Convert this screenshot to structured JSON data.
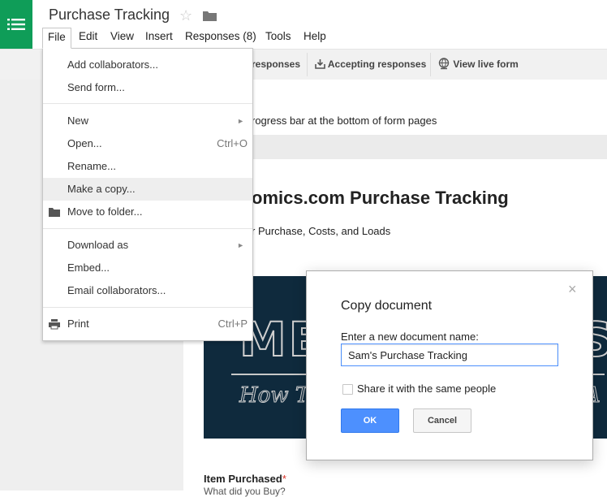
{
  "header": {
    "title": "Purchase Tracking",
    "star_icon": "star-icon",
    "folder_icon": "folder-icon",
    "app_icon": "forms-list-icon",
    "brand_color": "#0f9d58"
  },
  "menubar": {
    "file": "File",
    "edit": "Edit",
    "view": "View",
    "insert": "Insert",
    "responses": "Responses (8)",
    "tools": "Tools",
    "help": "Help"
  },
  "toolbar": {
    "view_responses": "responses",
    "accepting_responses": "Accepting responses",
    "view_live_form": "View live form"
  },
  "file_menu": {
    "add_collaborators": "Add collaborators...",
    "send_form": "Send form...",
    "new": "New",
    "open": "Open...",
    "open_shortcut": "Ctrl+O",
    "rename": "Rename...",
    "make_copy": "Make a copy...",
    "move_to_folder": "Move to folder...",
    "download_as": "Download as",
    "embed": "Embed...",
    "email_collaborators": "Email collaborators...",
    "print": "Print",
    "print_shortcut": "Ctrl+P"
  },
  "form": {
    "progress_text": "rogress bar at the bottom of form pages",
    "title": "omics.com Purchase Tracking",
    "description": "r Purchase, Costs, and Loads",
    "banner_big_left": "ME",
    "banner_big_right": "S",
    "banner_script_left": "How T",
    "banner_script_right": "A",
    "item_label": "Item Purchased",
    "item_required_mark": "*",
    "item_help": "What did you Buy?"
  },
  "dialog": {
    "title": "Copy document",
    "close_glyph": "×",
    "prompt": "Enter a new document name:",
    "input_value": "Sam's Purchase Tracking",
    "share_label": "Share it with the same people",
    "share_checked": false,
    "ok_label": "OK",
    "cancel_label": "Cancel",
    "ok_color": "#4d90fe"
  }
}
